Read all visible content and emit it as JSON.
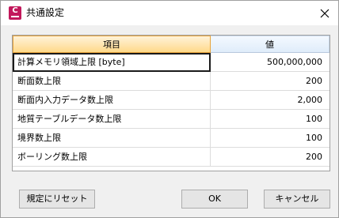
{
  "dialog": {
    "title": "共通設定",
    "app_icon": "app-logo-icon",
    "close_icon": "close-icon"
  },
  "table": {
    "headers": [
      "項目",
      "値"
    ],
    "rows": [
      {
        "name": "計算メモリ領域上限 [byte]",
        "value": "500,000,000"
      },
      {
        "name": "断面数上限",
        "value": "200"
      },
      {
        "name": "断面内入力データ数上限",
        "value": "2,000"
      },
      {
        "name": "地質テーブルデータ数上限",
        "value": "100"
      },
      {
        "name": "境界数上限",
        "value": "100"
      },
      {
        "name": "ボーリング数上限",
        "value": "200"
      }
    ],
    "selected_row": 0
  },
  "buttons": {
    "reset_label": "規定にリセット",
    "ok_label": "OK",
    "cancel_label": "キャンセル"
  },
  "colors": {
    "selected_header_border": "#e8a33a",
    "app_icon": "#c2185b"
  }
}
